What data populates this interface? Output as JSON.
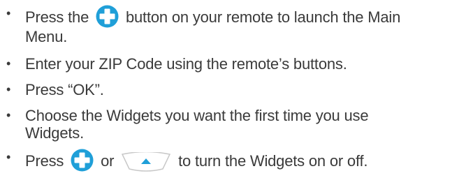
{
  "instructions": {
    "items": [
      {
        "bullet": "•",
        "text_before": "Press the",
        "icon": "plus-button-icon",
        "text_after": "button on your remote to launch the Main",
        "text_line2": "Menu."
      },
      {
        "bullet": "•",
        "text": "Enter your ZIP Code using the remote’s buttons."
      },
      {
        "bullet": "•",
        "text": "Press “OK”."
      },
      {
        "bullet": "•",
        "text": "Choose the Widgets you want the first time you use",
        "text_line2": "Widgets."
      },
      {
        "bullet": "•",
        "text_before": "Press",
        "icon1": "plus-button-icon",
        "text_mid": "or",
        "icon2": "up-arrow-button-icon",
        "text_after": "to turn the Widgets on or off."
      }
    ]
  },
  "colors": {
    "text": "#3a3a3a",
    "icon_blue": "#1f9fd8",
    "icon_outline": "#c8c8c8"
  }
}
